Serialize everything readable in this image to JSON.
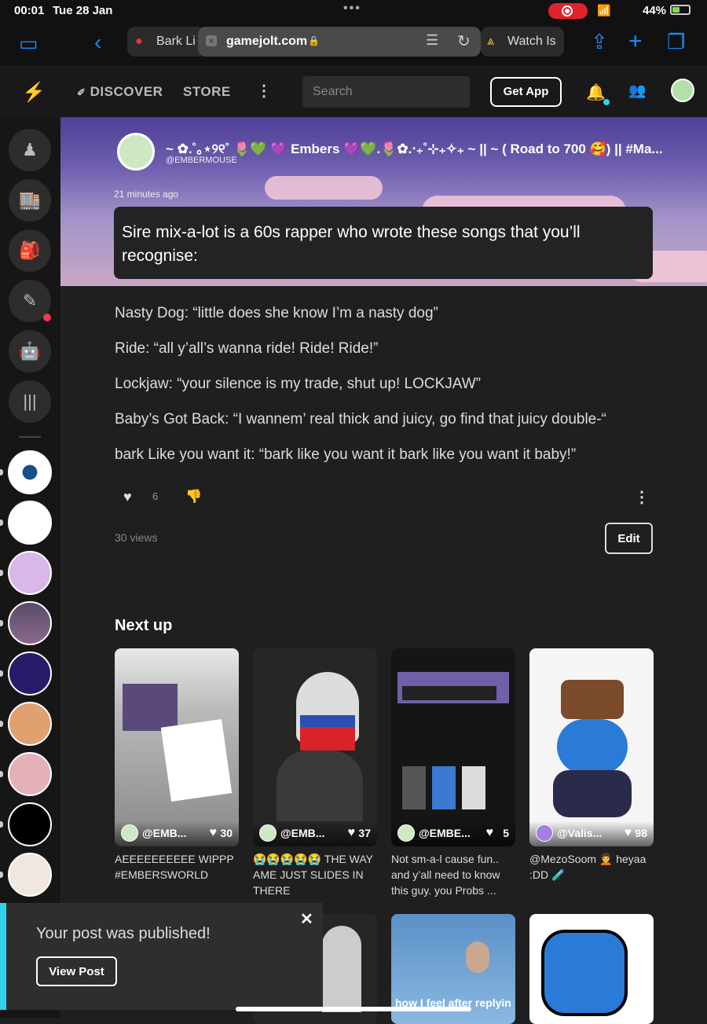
{
  "status_bar": {
    "time": "00:01",
    "date": "Tue 28 Jan",
    "battery": "44%",
    "battery_level": 0.44
  },
  "browser": {
    "tab_left": "Bark Li",
    "url": "gamejolt.com",
    "tab_right": "Watch Is"
  },
  "header": {
    "nav_discover": "DISCOVER",
    "nav_store": "STORE",
    "search_placeholder": "Search",
    "get_app": "Get App"
  },
  "post": {
    "author_name": "~ ✿.˚｡⋆୨୧˚ 🌷💚 💜 Embers 💜💚.🌷✿.‧₊˚⊹₊✧₊ ~ || ~ ( Road to 700 🥰) || #Ma...",
    "author_handle": "@EMBERMOUSE",
    "time": "21 minutes ago",
    "lead": "Sire mix-a-lot is a 60s rapper who wrote these songs that you’ll recognise:",
    "lines": [
      "Nasty Dog: “little does she know I’m a nasty dog”",
      "Ride: “all y’all’s wanna ride! Ride! Ride!”",
      "Lockjaw: “your silence is my trade, shut up! LOCKJAW”",
      "Baby’s Got Back: “I wannem’ real thick and juicy, go find that juicy double-“",
      "bark Like you want it: “bark like you want it bark like you want it baby!”"
    ],
    "likes": "6",
    "views": "30 views",
    "edit": "Edit"
  },
  "next_up": {
    "title": "Next up",
    "cards": [
      {
        "user": "@EMB...",
        "likes": "30",
        "caption": "AEEEEEEEEEE WIPPP #EMBERSWORLD"
      },
      {
        "user": "@EMB...",
        "likes": "37",
        "caption": "😭😭😭😭😭 THE WAY AME JUST SLIDES IN THERE"
      },
      {
        "user": "@EMBE...",
        "likes": "5",
        "caption": "Not sm-a-l cause fun.. and y’all need to know this guy. you Probs ..."
      },
      {
        "user": "@Valis...",
        "likes": "98",
        "caption": "@MezoSoom 🧑‍🦱 heyaa :DD 🧪"
      }
    ],
    "row2_caption": "how I feel after replyin"
  },
  "toast": {
    "message": "Your post was published!",
    "button": "View Post"
  }
}
